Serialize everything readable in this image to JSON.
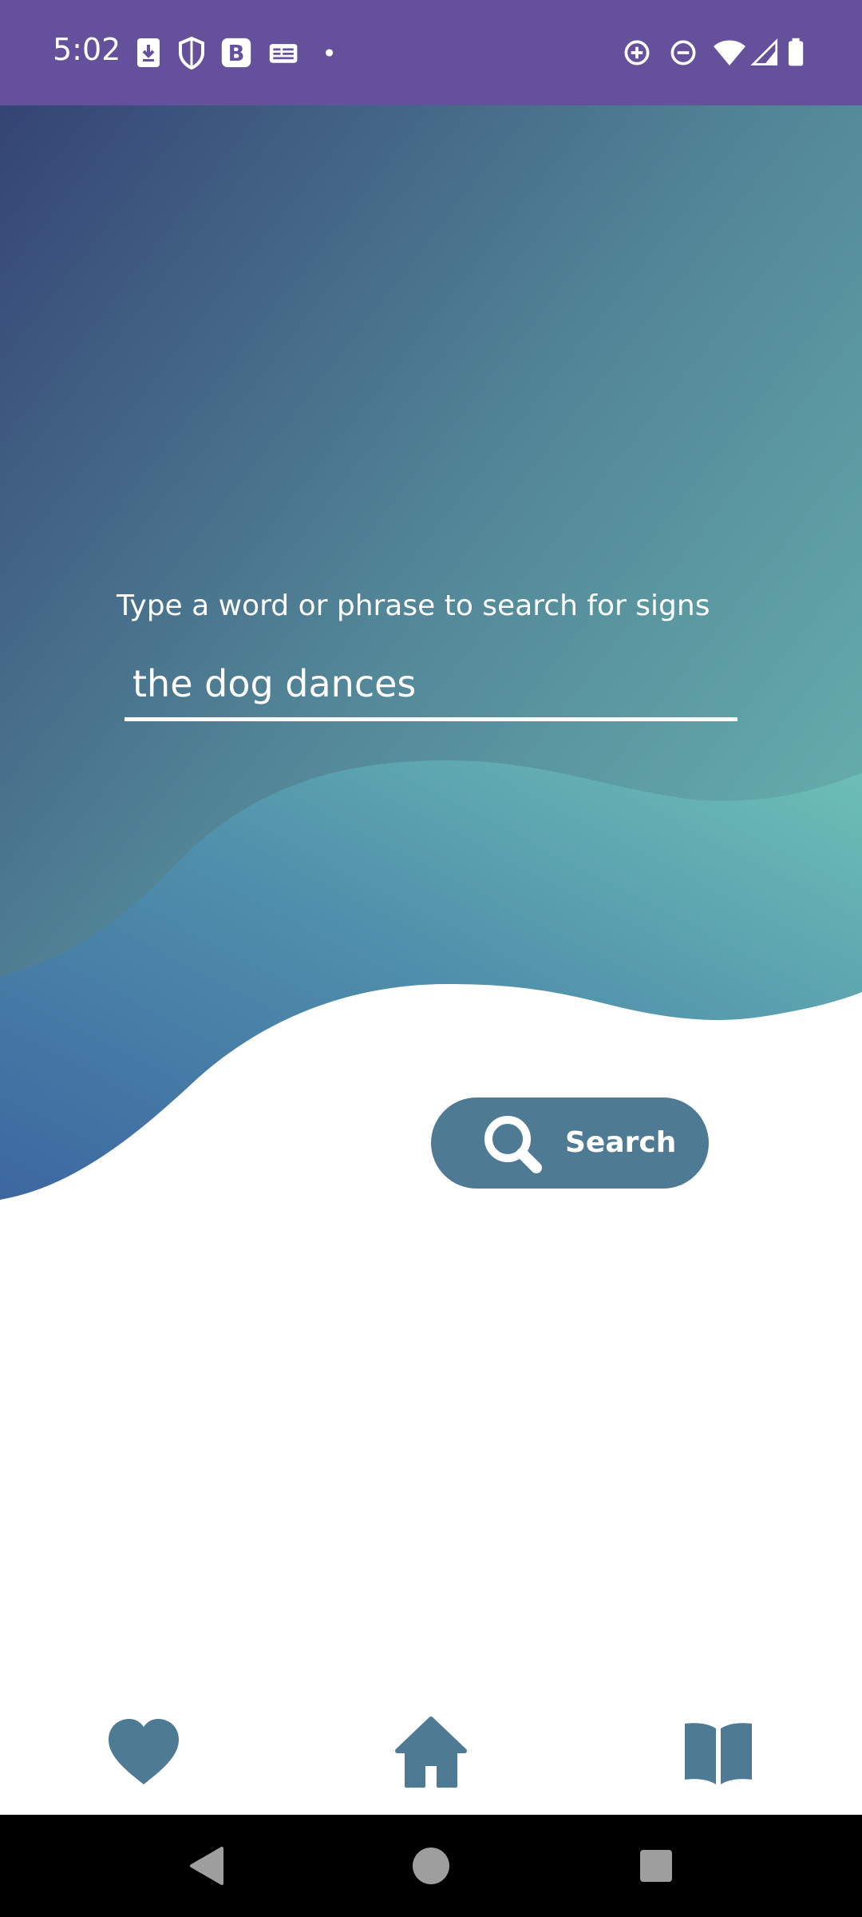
{
  "status_bar": {
    "time": "5:02",
    "left_icons": [
      "download-icon",
      "shield-icon",
      "bold-b-icon",
      "news-icon",
      "dot-icon"
    ],
    "right_icons": [
      "data-saver-icon",
      "do-not-disturb-icon",
      "wifi-icon",
      "signal-icon",
      "battery-icon"
    ]
  },
  "search": {
    "prompt": "Type a word or phrase to search for signs",
    "value": "the dog dances",
    "button_label": "Search"
  },
  "bottom_nav": {
    "items": [
      {
        "icon": "heart-icon"
      },
      {
        "icon": "home-icon"
      },
      {
        "icon": "book-icon"
      }
    ]
  },
  "system_nav": {
    "items": [
      "back-icon",
      "home-circle-icon",
      "recents-icon"
    ]
  },
  "colors": {
    "status_bar": "#65509c",
    "accent": "#4e7a93",
    "gradient_start": "#344474",
    "gradient_end": "#6ec0b6"
  }
}
